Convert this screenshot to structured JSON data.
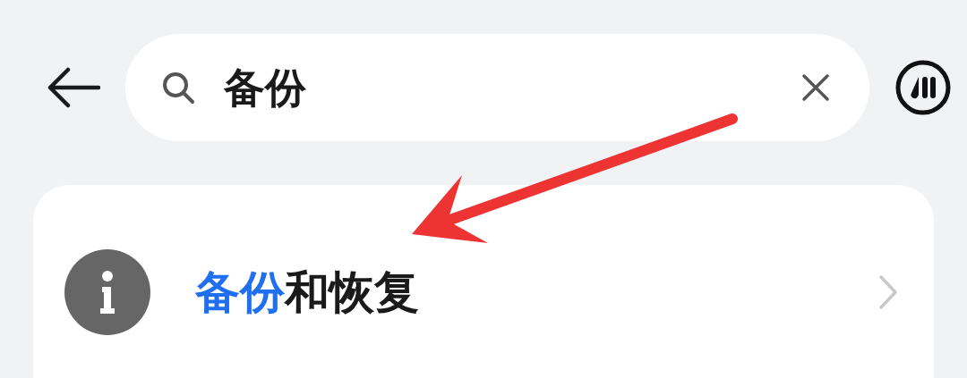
{
  "search": {
    "value": "备份"
  },
  "results": [
    {
      "title_parts": [
        {
          "text": "备份",
          "highlighted": true
        },
        {
          "text": "和恢复",
          "highlighted": false
        }
      ]
    }
  ]
}
